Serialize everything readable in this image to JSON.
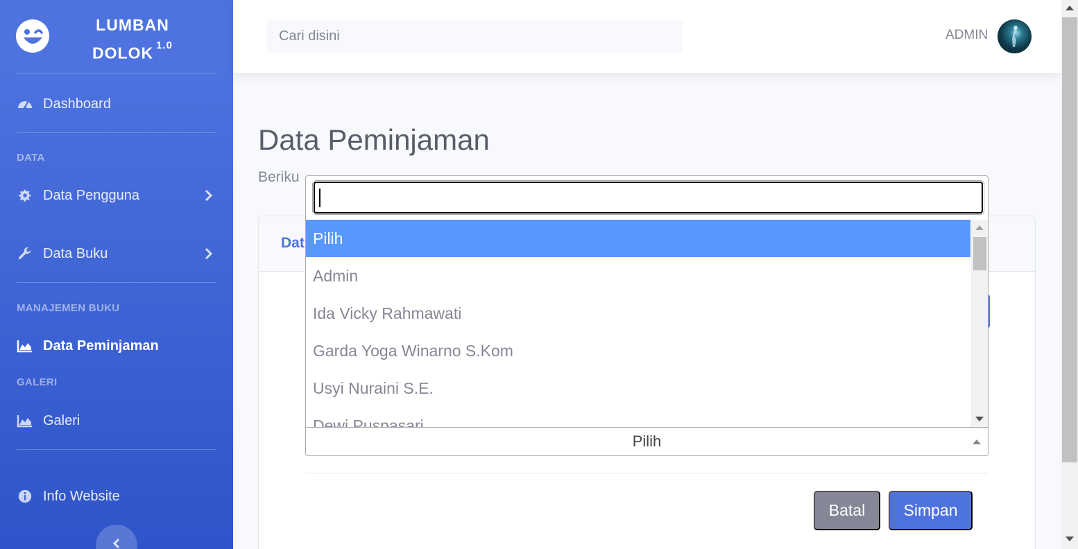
{
  "brand": {
    "line1": "LUMBAN",
    "line2": "DOLOK",
    "version": "1.0"
  },
  "sidebar": {
    "dashboard": "Dashboard",
    "heading_data": "DATA",
    "data_pengguna": "Data Pengguna",
    "data_buku": "Data Buku",
    "heading_manajemen": "MANAJEMEN BUKU",
    "data_peminjaman": "Data Peminjaman",
    "heading_galeri": "GALERI",
    "galeri": "Galeri",
    "info_website": "Info Website",
    "active_item": "Data Peminjaman"
  },
  "topbar": {
    "search_placeholder": "Cari disini",
    "user_name": "ADMIN"
  },
  "main": {
    "page_title": "Data Peminjaman",
    "page_subtitle_visible": "Beriku",
    "card_title_visible": "Dat"
  },
  "select": {
    "search_value": "",
    "selected_label": "Pilih",
    "options": [
      "Pilih",
      "Admin",
      "Ida Vicky Rahmawati",
      "Garda Yoga Winarno S.Kom",
      "Usyi Nuraini S.E.",
      "Dewi Puspasari"
    ]
  },
  "buttons": {
    "cancel": "Batal",
    "save": "Simpan"
  },
  "colors": {
    "sidebar_top": "#4e73df",
    "sidebar_bottom": "#2f54c9",
    "primary": "#4e73df",
    "secondary": "#858796",
    "option_highlight": "#5897fb"
  }
}
